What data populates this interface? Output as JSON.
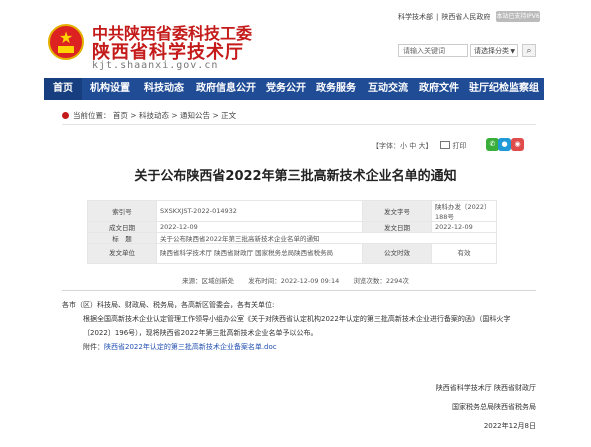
{
  "header": {
    "title_line1": "中共陕西省委科技工委",
    "title_line2": "陕西省科学技术厅",
    "domain": "kjt.shaanxi.gov.cn",
    "top_links": [
      "科学技术部",
      "|",
      "陕西省人民政府"
    ],
    "badge": "本站已支持IPV6",
    "search_placeholder": "请输入关键词",
    "search_scope": "请选择分类"
  },
  "nav": {
    "items": [
      "首页",
      "机构设置",
      "科技动态",
      "政府信息公开",
      "党务公开",
      "政务服务",
      "互动交流",
      "政府文件",
      "驻厅纪检监察组"
    ]
  },
  "breadcrumb": {
    "prefix": "当前位置：",
    "path": [
      "首页",
      ">",
      "科技动态",
      ">",
      "通知公告",
      ">",
      "正文"
    ]
  },
  "tools": {
    "font_label": "【字体：小 中 大】",
    "print_label": "打印"
  },
  "article": {
    "title": "关于公布陕西省2022年第三批高新技术企业名单的通知",
    "info": {
      "index_label": "索引号",
      "index_value": "SXSKXJST-2022-014932",
      "doc_no_label": "发文字号",
      "doc_no_value": "陕科办发〔2022〕188号",
      "date_label": "成文日期",
      "date_value": "2022-12-09",
      "pub_date_label": "发文日期",
      "pub_date_value": "2022-12-09",
      "subject_label": "标　题",
      "subject_value": "关于公布陕西省2022年第三批高新技术企业名单的通知",
      "issuer_label": "发文单位",
      "issuer_value": "陕西省科学技术厅 陕西省财政厅 国家税务总局陕西省税务局",
      "validity_label": "公文时效",
      "validity_value": "有效"
    },
    "meta": {
      "source": "来源：区域创新处",
      "pub_time": "发布时间：2022-12-09 09:14",
      "views": "浏览次数：2294次"
    },
    "body": {
      "greeting": "各市（区）科技局、财政局、税务局，各高新区管委会，各有关单位:",
      "para1": "根据全国高新技术企业认定管理工作领导小组办公室《关于对陕西省认定机构2022年认定的第三批高新技术企业进行备案的函》（国科火字〔2022〕196号），现将陕西省2022年第三批高新技术企业名单予以公布。",
      "attachment_prefix": "附件：",
      "attachment_link": "陕西省2022年认定的第三批高新技术企业备案名单.doc",
      "sign1": "陕西省科学技术厅 陕西省财政厅",
      "sign2": "国家税务总局陕西省税务局",
      "sign_date": "2022年12月8日"
    }
  },
  "colors": {
    "brand_red": "#c41a1a",
    "nav_blue": "#1f4c95",
    "link_blue": "#2250b0"
  }
}
